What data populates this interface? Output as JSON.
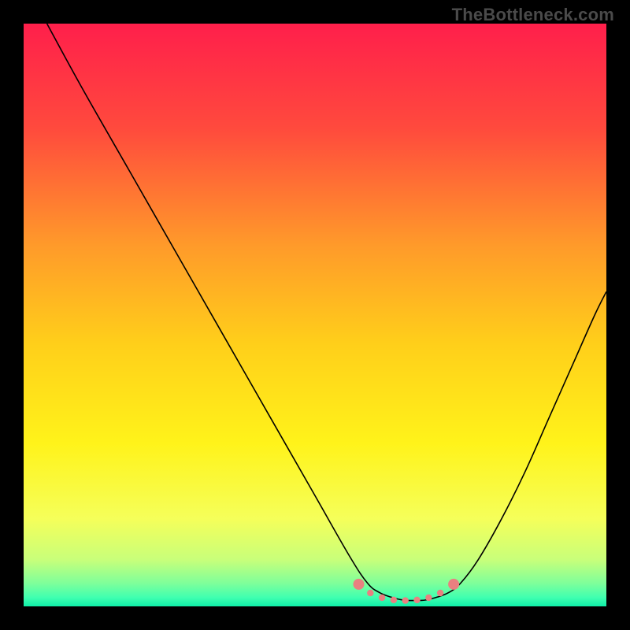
{
  "watermark": "TheBottleneck.com",
  "chart_data": {
    "type": "line",
    "title": "",
    "xlabel": "",
    "ylabel": "",
    "xlim": [
      0,
      100
    ],
    "ylim": [
      0,
      100
    ],
    "grid": false,
    "legend": false,
    "background_gradient": {
      "stops": [
        {
          "offset": 0.0,
          "color": "#ff1f4b"
        },
        {
          "offset": 0.18,
          "color": "#ff4a3d"
        },
        {
          "offset": 0.38,
          "color": "#ff9a2a"
        },
        {
          "offset": 0.55,
          "color": "#ffcf1a"
        },
        {
          "offset": 0.72,
          "color": "#fff31a"
        },
        {
          "offset": 0.85,
          "color": "#f5ff5a"
        },
        {
          "offset": 0.92,
          "color": "#c8ff7a"
        },
        {
          "offset": 0.96,
          "color": "#7fff9a"
        },
        {
          "offset": 0.985,
          "color": "#3fffb0"
        },
        {
          "offset": 1.0,
          "color": "#0fefa8"
        }
      ]
    },
    "series": [
      {
        "name": "curve",
        "stroke": "#000000",
        "stroke_width": 1.6,
        "x": [
          4.0,
          10,
          18,
          26,
          34,
          42,
          50,
          56,
          59,
          61,
          63,
          65,
          67,
          69,
          71,
          73,
          75,
          78,
          82,
          86,
          90,
          94,
          98,
          100
        ],
        "y": [
          100,
          89,
          75,
          61,
          47,
          33,
          19,
          8.5,
          4.0,
          2.4,
          1.6,
          1.1,
          1.0,
          1.1,
          1.6,
          2.4,
          4.0,
          8.0,
          15,
          23,
          32,
          41,
          50,
          54
        ]
      }
    ],
    "markers": {
      "name": "bottom-dots",
      "color": "#e98080",
      "radius_primary": 7,
      "radius_secondary": 4.2,
      "points": [
        {
          "x": 57.5,
          "y": 3.8,
          "r": "primary"
        },
        {
          "x": 59.5,
          "y": 2.3,
          "r": "secondary"
        },
        {
          "x": 61.5,
          "y": 1.5,
          "r": "secondary"
        },
        {
          "x": 63.5,
          "y": 1.1,
          "r": "secondary"
        },
        {
          "x": 65.5,
          "y": 1.0,
          "r": "secondary"
        },
        {
          "x": 67.5,
          "y": 1.1,
          "r": "secondary"
        },
        {
          "x": 69.5,
          "y": 1.5,
          "r": "secondary"
        },
        {
          "x": 71.5,
          "y": 2.3,
          "r": "secondary"
        },
        {
          "x": 73.8,
          "y": 3.8,
          "r": "primary"
        }
      ]
    }
  }
}
